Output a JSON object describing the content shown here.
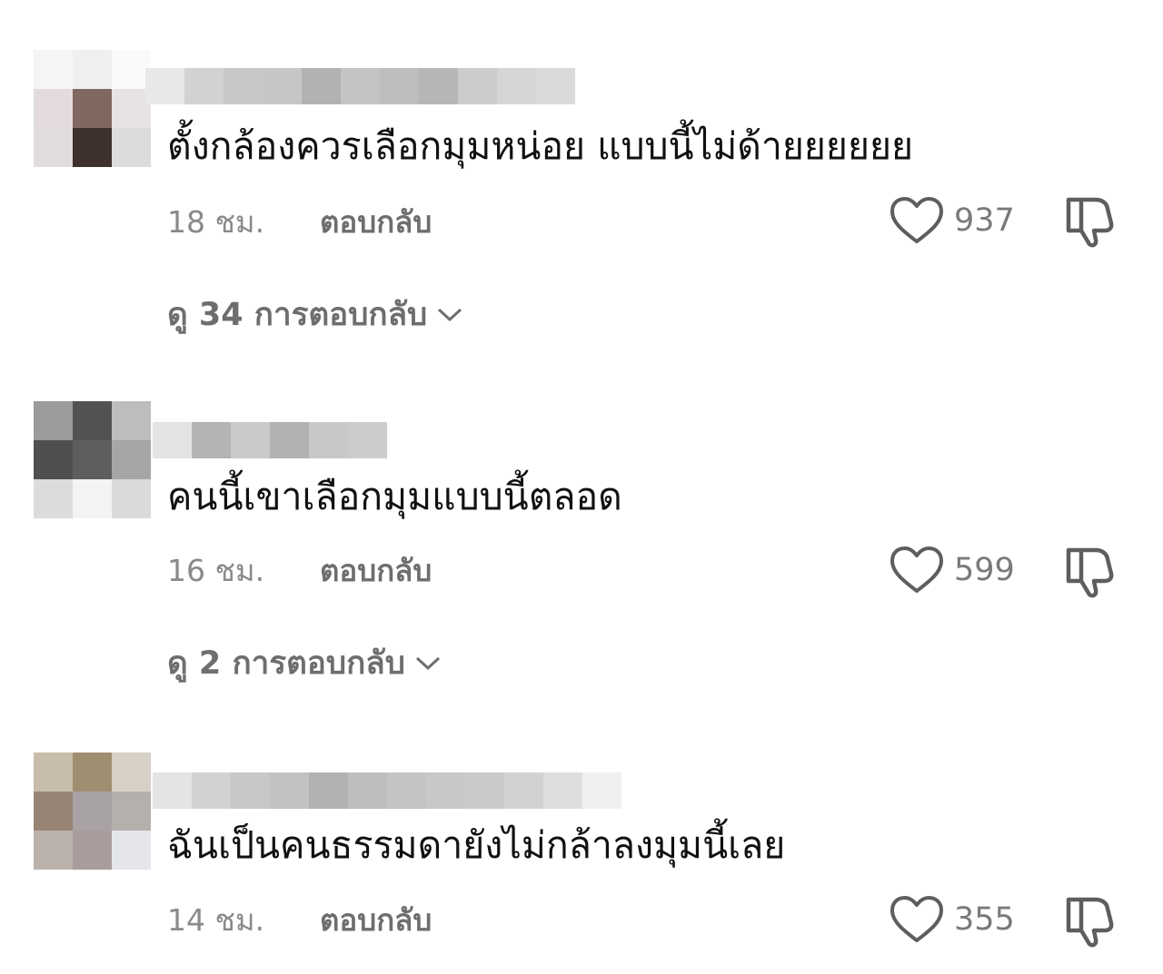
{
  "comments": [
    {
      "text": "ตั้งกล้องควรเลือกมุมหน่อย แบบนี้ไม่ด้ายยยยยย",
      "time": "18 ชม.",
      "reply_label": "ตอบกลับ",
      "likes": "937",
      "replies_label": "ดู 34 การตอบกลับ",
      "avatar_colors": [
        "#f6f4f4",
        "#efeff1",
        "#fafafa",
        "#e4dcdc",
        "#806860",
        "#e8e2e2",
        "#e0dcdc",
        "#3e302c",
        "#dcdcdc"
      ],
      "username_colors": [
        "#e8e8e8",
        "#d2d2d2",
        "#c8c8c8",
        "#c6c6c6",
        "#b2b2b2",
        "#c4c4c4",
        "#bebebe",
        "#b6b6b6",
        "#cccccc",
        "#d6d6d6",
        "#dadada"
      ]
    },
    {
      "text": "คนนี้เขาเลือกมุมแบบนี้ตลอด",
      "time": "16 ชม.",
      "reply_label": "ตอบกลับ",
      "likes": "599",
      "replies_label": "ดู 2 การตอบกลับ",
      "avatar_colors": [
        "#9a9c9c",
        "#505254",
        "#bcbebe",
        "#4e5050",
        "#5c5e60",
        "#a4a6a8",
        "#dcdcda",
        "#f2f4f2",
        "#dadada"
      ],
      "username_colors": [
        "#e4e4e4",
        "#b4b4b4",
        "#cacaca",
        "#b2b2b2",
        "#c8c8c8",
        "#cccccc"
      ]
    },
    {
      "text": "ฉันเป็นคนธรรมดายังไม่กล้าลงมุมนี้เลย",
      "time": "14 ชม.",
      "reply_label": "ตอบกลับ",
      "likes": "355",
      "avatar_colors": [
        "#c8bcaa",
        "#a08e70",
        "#d6d0c6",
        "#988474",
        "#a8a2a4",
        "#b6b0ac",
        "#bcb2ac",
        "#a89c9c",
        "#e4e6ea"
      ],
      "username_colors": [
        "#e4e4e4",
        "#d2d2d2",
        "#c8c8c8",
        "#c2c2c2",
        "#b2b2b2",
        "#bebebe",
        "#c4c4c4",
        "#c8c8c8",
        "#cacaca",
        "#d2d2d2",
        "#dedede",
        "#f0f0f0"
      ]
    }
  ],
  "colors": {
    "text": "#111111",
    "meta": "#8a8a8a",
    "reply": "#6e6e6e",
    "icon": "#5e5e5e"
  },
  "icons": {
    "like": "heart-outline-icon",
    "dislike": "thumbs-down-outline-icon",
    "expand": "chevron-down-icon"
  }
}
